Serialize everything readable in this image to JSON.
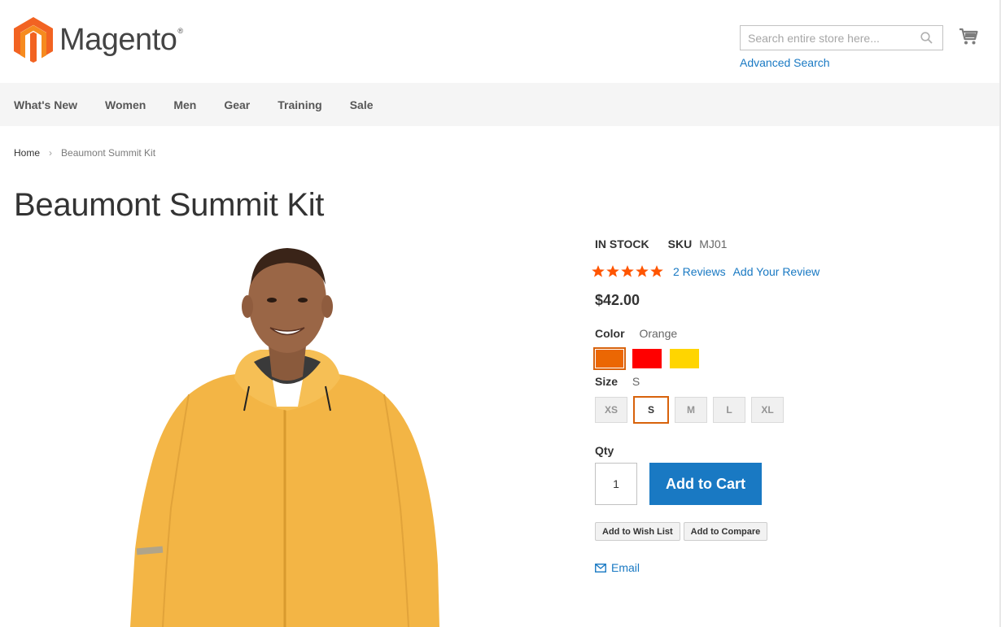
{
  "header": {
    "logo_text": "Magento",
    "logo_mark": "®",
    "search_placeholder": "Search entire store here...",
    "advanced_search": "Advanced Search"
  },
  "nav": {
    "items": [
      "What's New",
      "Women",
      "Men",
      "Gear",
      "Training",
      "Sale"
    ]
  },
  "breadcrumbs": {
    "home": "Home",
    "separator": "›",
    "current": "Beaumont Summit Kit"
  },
  "product": {
    "title": "Beaumont Summit Kit",
    "stock": "IN STOCK",
    "sku_label": "SKU",
    "sku": "MJ01",
    "rating_stars": 5,
    "reviews_link": "2 Reviews",
    "add_review_link": "Add Your Review",
    "price": "$42.00",
    "color_label": "Color",
    "color_selected": "Orange",
    "colors": [
      {
        "name": "Orange",
        "hex": "#eb6703"
      },
      {
        "name": "Red",
        "hex": "#ff0000"
      },
      {
        "name": "Yellow",
        "hex": "#ffd500"
      }
    ],
    "size_label": "Size",
    "size_selected": "S",
    "sizes": [
      "XS",
      "S",
      "M",
      "L",
      "XL"
    ],
    "qty_label": "Qty",
    "qty_value": "1",
    "add_to_cart": "Add to Cart",
    "add_to_wishlist": "Add to Wish List",
    "add_to_compare": "Add to Compare",
    "email": "Email"
  },
  "colors": {
    "accent_blue": "#1979c3",
    "selected_orange": "#d8620b",
    "star_orange": "#ff5501",
    "nav_bg": "#f5f5f5"
  },
  "icons": {
    "search": "search-icon",
    "cart": "cart-icon",
    "star": "star-icon",
    "email": "envelope-icon"
  }
}
